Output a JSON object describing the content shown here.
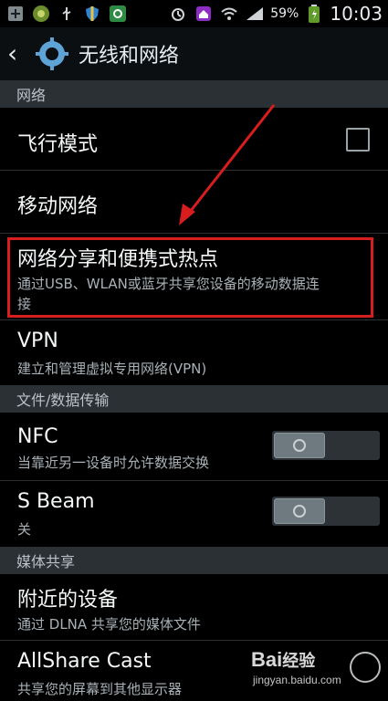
{
  "status_bar": {
    "time": "10:03",
    "battery_percent": "59%",
    "left_icons": [
      "plus-icon",
      "android-icon",
      "usb-icon",
      "shield-icon",
      "recycle-icon"
    ],
    "right_icons": [
      "alarm-icon",
      "home-icon",
      "wifi-icon",
      "signal-icon",
      "battery-icon"
    ]
  },
  "action_bar": {
    "title": "无线和网络",
    "icon": "gear-icon"
  },
  "sections": {
    "network": "网络",
    "file_data_transfer": "文件/数据传输",
    "media_sharing": "媒体共享"
  },
  "items": {
    "airplane_mode": {
      "label": "飞行模式",
      "checked": false
    },
    "mobile_network": {
      "label": "移动网络"
    },
    "tethering": {
      "label": "网络分享和便携式热点",
      "summary_line1": "通过USB、WLAN或蓝牙共享您设备的移动数据连",
      "summary_line2": "接"
    },
    "vpn": {
      "label": "VPN",
      "summary": "建立和管理虚拟专用网络(VPN)"
    },
    "nfc": {
      "label": "NFC",
      "summary": "当靠近另一设备时允许数据交换",
      "enabled": false
    },
    "s_beam": {
      "label": "S Beam",
      "summary": "关",
      "enabled": false
    },
    "nearby_devices": {
      "label": "附近的设备",
      "summary": "通过 DLNA 共享您的媒体文件"
    },
    "allshare_cast": {
      "label": "AllShare Cast",
      "summary": "共享您的屏幕到其他显示器"
    }
  },
  "colors": {
    "highlight": "#d71d1d",
    "section_bg": "#2b3034",
    "screen_bg": "#000000"
  },
  "watermark": {
    "brand": "Bai",
    "brand2": "经验",
    "url": "jingyan.baidu.com"
  }
}
